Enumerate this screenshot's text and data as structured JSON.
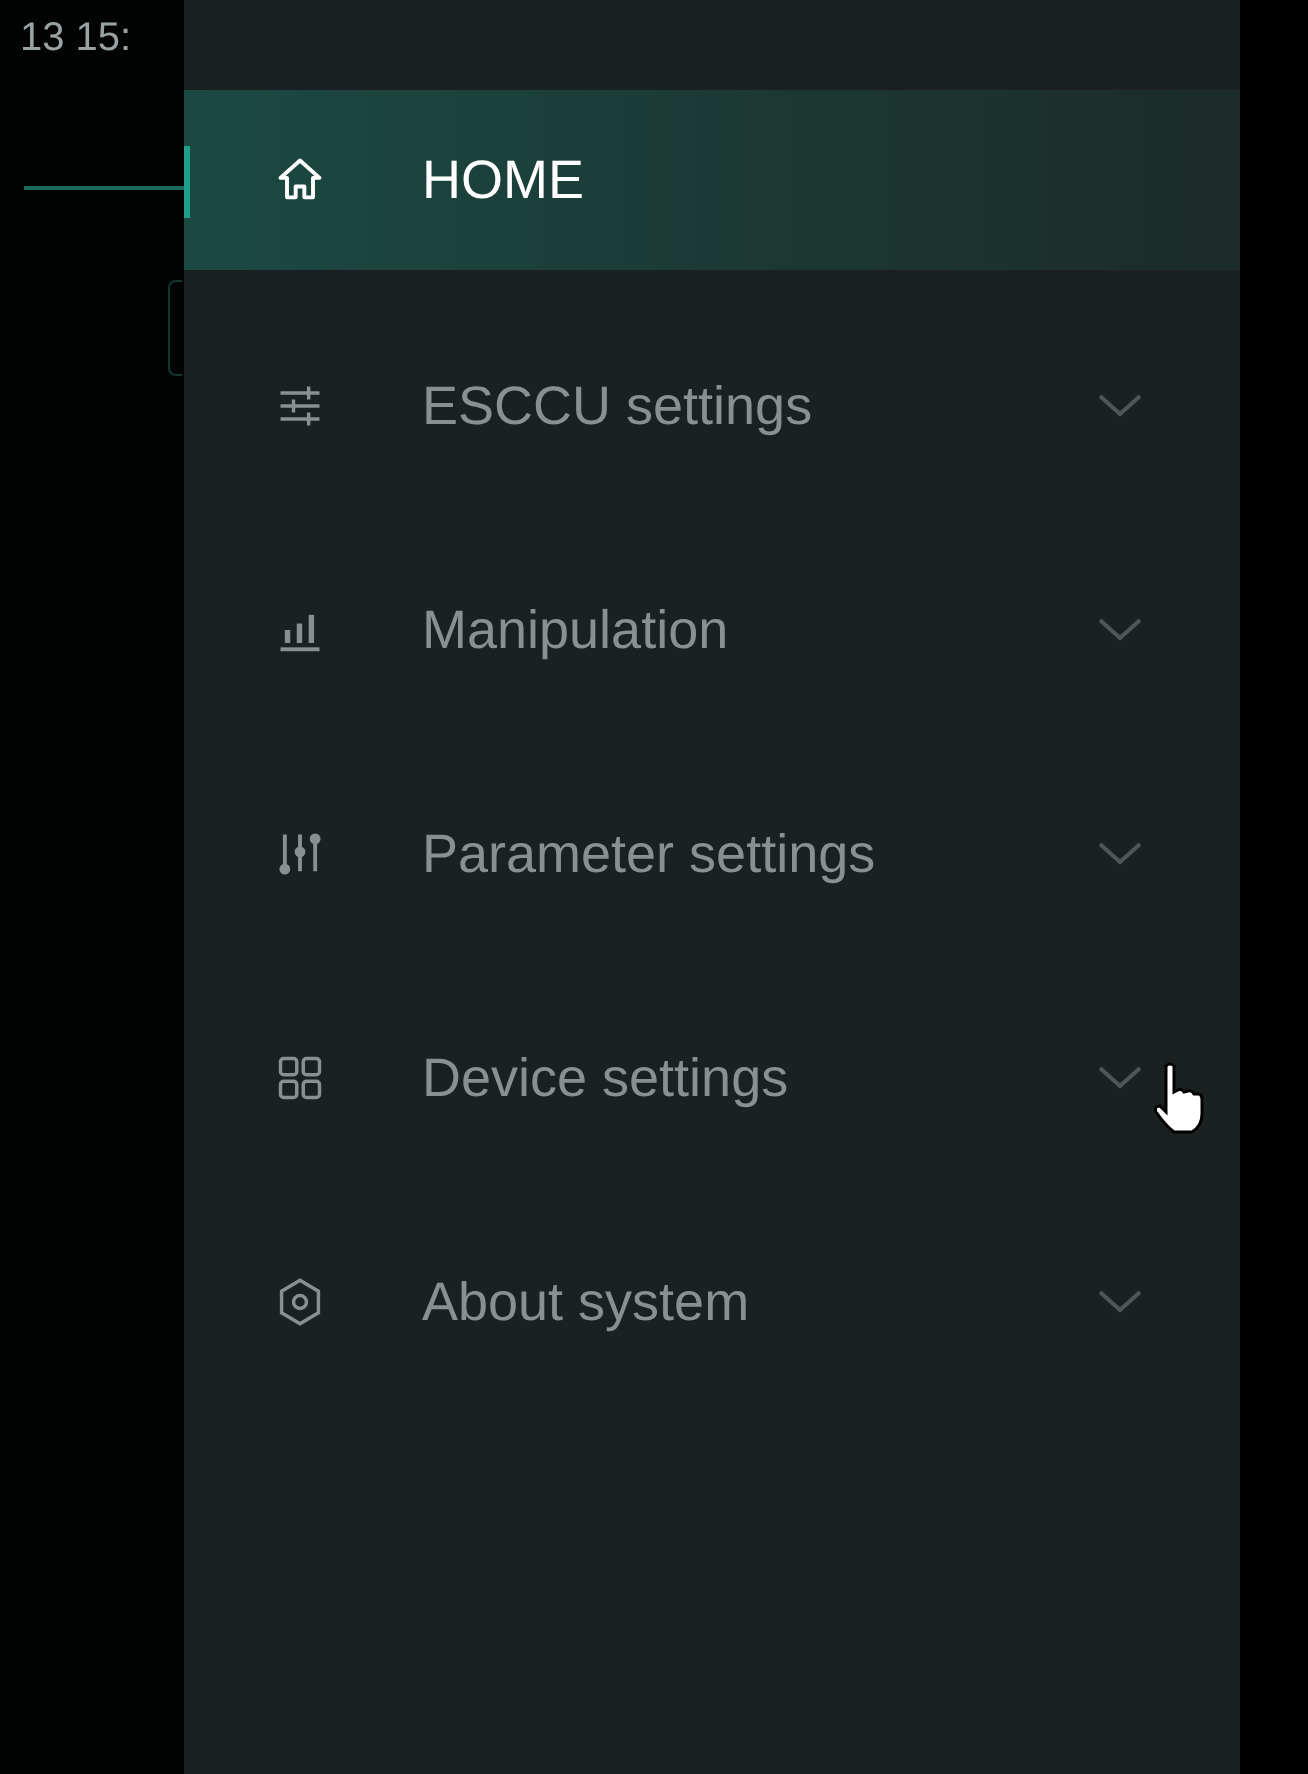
{
  "background": {
    "timestamp": "13 15:"
  },
  "sidebar": {
    "items": [
      {
        "label": "HOME",
        "kind": "link",
        "selected": true
      },
      {
        "label": "ESCCU settings",
        "kind": "submenu",
        "selected": false
      },
      {
        "label": "Manipulation",
        "kind": "submenu",
        "selected": false
      },
      {
        "label": "Parameter settings",
        "kind": "submenu",
        "selected": false
      },
      {
        "label": "Device settings",
        "kind": "submenu",
        "selected": false
      },
      {
        "label": "About system",
        "kind": "submenu",
        "selected": false
      }
    ]
  }
}
